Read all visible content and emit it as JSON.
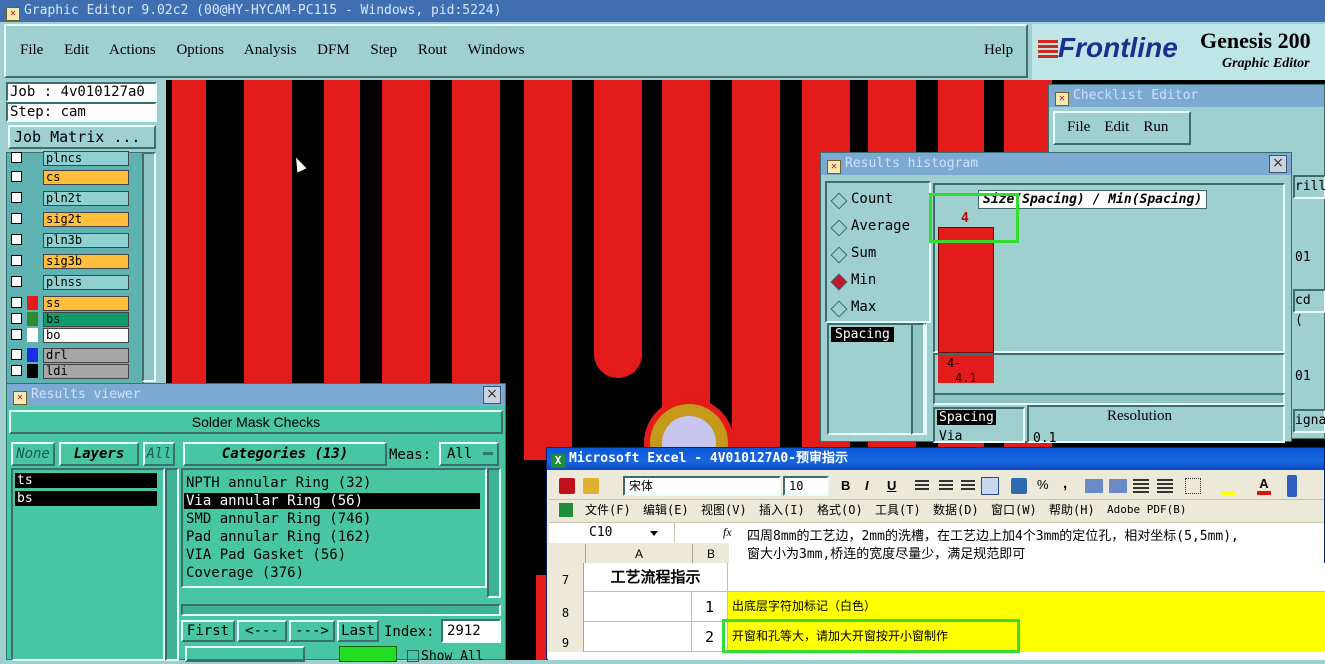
{
  "app": {
    "title": "Graphic Editor 9.02c2 (00@HY-HYCAM-PC115 - Windows, pid:5224)",
    "menu": [
      "File",
      "Edit",
      "Actions",
      "Options",
      "Analysis",
      "DFM",
      "Step",
      "Rout",
      "Windows"
    ],
    "help": "Help",
    "brand": "Frontline",
    "product": "Genesis 200",
    "product_sub": "Graphic Editor"
  },
  "job": {
    "job_label": "Job : 4v010127a0",
    "step_label": "Step: cam",
    "matrix_button": "Job Matrix ..."
  },
  "layers": [
    {
      "name": "plncs",
      "color": "#8fd0d0"
    },
    {
      "name": "cs",
      "color": "#ffbf3b"
    },
    {
      "name": "pln2t",
      "color": "#8fd0d0"
    },
    {
      "name": "sig2t",
      "color": "#ffbf3b"
    },
    {
      "name": "pln3b",
      "color": "#8fd0d0"
    },
    {
      "name": "sig3b",
      "color": "#ffbf3b"
    },
    {
      "name": "plnss",
      "color": "#8fd0d0"
    },
    {
      "name": "ss",
      "color": "#ffbf3b",
      "swatch": "#e31b1b"
    },
    {
      "name": "bs",
      "color": "#0e9c6b",
      "swatch": "#2e8b2e"
    },
    {
      "name": "bo",
      "color": "#ffffff",
      "swatch": "#ffffff"
    },
    {
      "name": "drl",
      "color": "#a6a6a6",
      "swatch": "#1a2fe0"
    },
    {
      "name": "ldi",
      "color": "#a6a6a6",
      "swatch": "#000000"
    }
  ],
  "results_viewer": {
    "title": "Results viewer",
    "header": "Solder Mask Checks",
    "none_btn": "None",
    "layers_btn": "Layers",
    "all_btn": "All",
    "layers": [
      "ts",
      "bs"
    ],
    "categories_label": "Categories (13)",
    "meas_label": "Meas:",
    "meas_value": "All",
    "categories": [
      "NPTH annular Ring (32)",
      "Via annular Ring (56)",
      "SMD annular Ring (746)",
      "Pad annular Ring (162)",
      "VIA Pad Gasket (56)",
      "Coverage (376)"
    ],
    "selected_category": 1,
    "nav": [
      "First",
      "<---",
      "--->",
      "Last"
    ],
    "index_label": "Index:",
    "index_value": "2912",
    "show_all": "Show All"
  },
  "checklist": {
    "title": "Checklist Editor",
    "menu": [
      "File",
      "Edit",
      "Run"
    ],
    "right_fragments": [
      "rill",
      "01",
      "cd (",
      "01",
      "igna"
    ]
  },
  "histogram": {
    "title": "Results histogram",
    "modes": [
      "Count",
      "Average",
      "Sum",
      "Min",
      "Max"
    ],
    "selected_mode": "Min",
    "chart_label": "Size(Spacing) / Min(Spacing)",
    "bar_value": "4",
    "range_label_1": "4-",
    "range_label_2": "4.1",
    "spacing_list": [
      "Spacing"
    ],
    "bottom_list": [
      "Spacing",
      "Via"
    ],
    "resolution_label": "Resolution",
    "resolution_value": "0.1"
  },
  "excel": {
    "title": "Microsoft Excel - 4V010127A0-预审指示",
    "font_name": "宋体",
    "font_size": "10",
    "toolbar_buttons": [
      "B",
      "I",
      "U"
    ],
    "percent": "%",
    "comma": ",",
    "menu": [
      "文件(F)",
      "编辑(E)",
      "视图(V)",
      "插入(I)",
      "格式(O)",
      "工具(T)",
      "数据(D)",
      "窗口(W)",
      "帮助(H)",
      "Adobe PDF(B)"
    ],
    "cell_ref": "C10",
    "fx": "fx",
    "formula_line1": "四周8mm的工艺边，2mm的洗槽，在工艺边上加4个3mm的定位孔，相对坐标(5,5mm),",
    "formula_line2": "窗大小为3mm,桥连的宽度尽量少，满足规范即可",
    "col_a": "A",
    "col_b": "B",
    "row7": {
      "num": "7",
      "text": "工艺流程指示"
    },
    "row8": {
      "num": "8",
      "b": "1",
      "c": "出底层字符加标记（白色）"
    },
    "row9": {
      "num": "9",
      "b": "2",
      "c": "开窗和孔等大，请加大开窗按开小窗制作"
    },
    "highlight_color": "#ffff00"
  }
}
